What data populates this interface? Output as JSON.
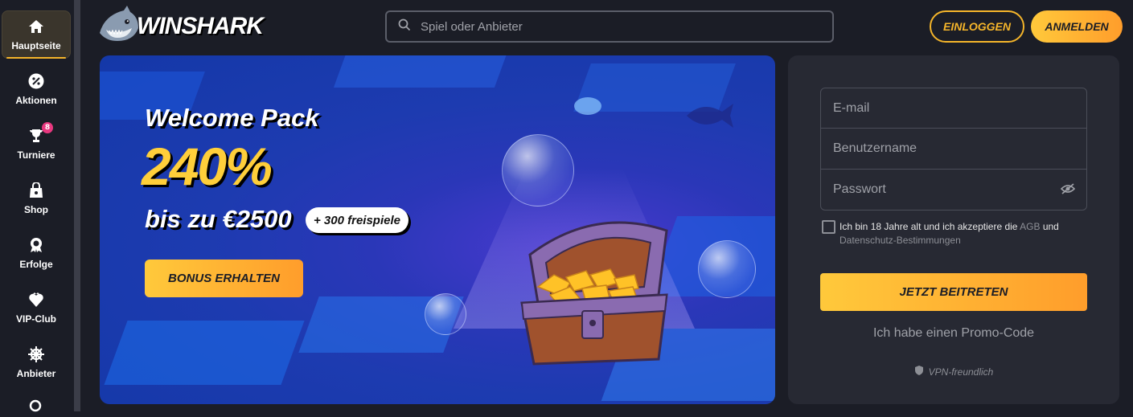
{
  "sidebar": {
    "items": [
      {
        "label": "Hauptseite",
        "icon": "home-icon",
        "active": true
      },
      {
        "label": "Aktionen",
        "icon": "percent-icon"
      },
      {
        "label": "Turniere",
        "icon": "trophy-icon",
        "badge": "8"
      },
      {
        "label": "Shop",
        "icon": "shop-bag-icon"
      },
      {
        "label": "Erfolge",
        "icon": "medal-icon"
      },
      {
        "label": "VIP-Club",
        "icon": "vip-heart-icon"
      },
      {
        "label": "Anbieter",
        "icon": "ship-wheel-icon"
      }
    ]
  },
  "header": {
    "logo_text": "WINSHARK",
    "search_placeholder": "Spiel oder Anbieter",
    "login_label": "EINLOGGEN",
    "register_label": "ANMELDEN"
  },
  "banner": {
    "title": "Welcome Pack",
    "percent": "240%",
    "amount": "bis zu €2500",
    "freespins": "+ 300 freispiele",
    "button": "BONUS ERHALTEN"
  },
  "register": {
    "email_placeholder": "E-mail",
    "username_placeholder": "Benutzername",
    "password_placeholder": "Passwort",
    "terms_part1": "Ich bin 18 Jahre alt und ich akzeptiere die ",
    "terms_agb": "AGB",
    "terms_part2": " und ",
    "terms_privacy": "Datenschutz-Bestimmungen",
    "join_button": "JETZT BEITRETEN",
    "promo_link": "Ich habe einen Promo-Code",
    "vpn_label": "VPN-freundlich"
  },
  "colors": {
    "accent": "#f5b52a",
    "background": "#1b1d26",
    "panel": "#272933",
    "badge": "#e8387f"
  }
}
